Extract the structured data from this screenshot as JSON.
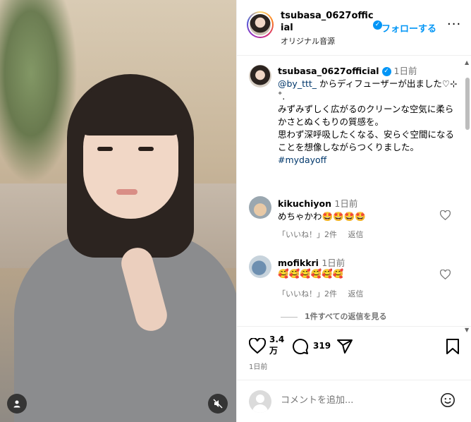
{
  "header": {
    "username": "tsubasa_0627official",
    "follow_label": "フォローする",
    "subtitle": "オリジナル音源",
    "more_glyph": "···"
  },
  "caption": {
    "username": "tsubasa_0627official",
    "time": "1日前",
    "mention": "@by_ttt_",
    "line1": " からディフューザーが出ました♡⊹ ˚.",
    "line2": "みずみずしく広がるのクリーンな空気に柔らかさとぬくもりの質感を。",
    "line3": "思わず深呼吸したくなる、安らぐ空間になることを想像しながらつくりました。",
    "hashtag": "#mydayoff"
  },
  "comments": [
    {
      "username": "kikuchiyon",
      "time": "1日前",
      "text": "めちゃかわ🤩🤩🤩🤩",
      "likes": "「いいね！」2件",
      "reply": "返信"
    },
    {
      "username": "mofikkri",
      "time": "1日前",
      "text": "🥰🥰🥰🥰🥰🥰",
      "likes": "「いいね！」2件",
      "reply": "返信"
    }
  ],
  "view_replies": "1件すべての返信を見る",
  "actions": {
    "likes_count": "3.4万",
    "comments_count": "319",
    "date": "1日前"
  },
  "add_comment": {
    "placeholder": "コメントを追加..."
  },
  "colors": {
    "link": "#0095f6",
    "muted": "#737373",
    "border": "#efefef"
  },
  "icons": [
    "heart-icon",
    "comment-icon",
    "share-icon",
    "bookmark-icon",
    "emoji-icon",
    "mute-icon",
    "user-tag-icon",
    "verified-icon",
    "more-icon"
  ]
}
